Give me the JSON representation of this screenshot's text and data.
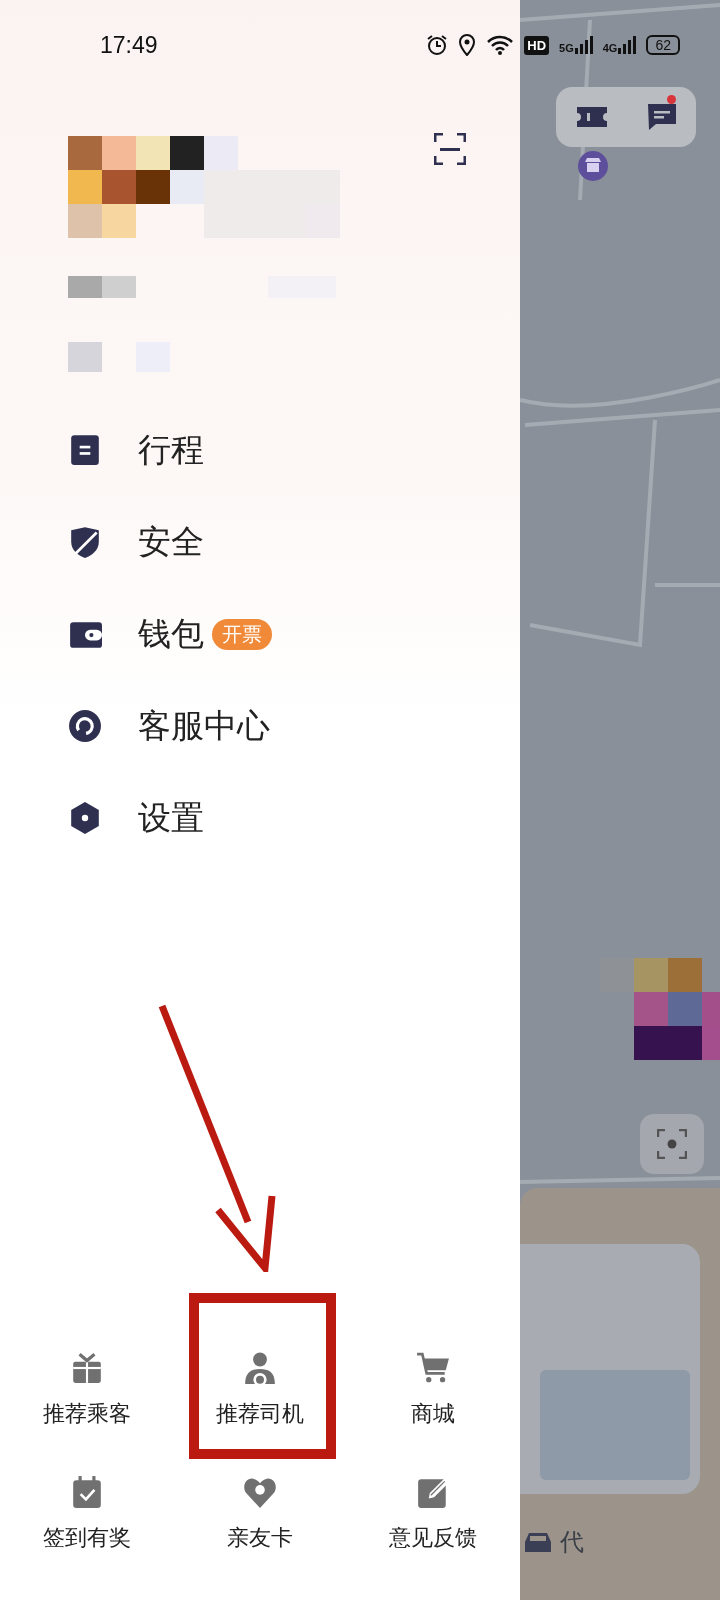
{
  "status_bar": {
    "time": "17:49",
    "hd_badge": "HD",
    "networks": [
      "5G",
      "4G"
    ],
    "battery": "62"
  },
  "profile": {
    "kind": "pixelated"
  },
  "menu": [
    {
      "label": "行程",
      "kind": "trips"
    },
    {
      "label": "安全",
      "kind": "safety"
    },
    {
      "label": "钱包",
      "kind": "wallet",
      "badge": "开票"
    },
    {
      "label": "客服中心",
      "kind": "service"
    },
    {
      "label": "设置",
      "kind": "settings"
    }
  ],
  "shortcuts": [
    {
      "label": "推荐乘客",
      "kind": "gift",
      "highlighted": false
    },
    {
      "label": "推荐司机",
      "kind": "driver",
      "highlighted": true
    },
    {
      "label": "商城",
      "kind": "cart",
      "highlighted": false
    },
    {
      "label": "签到有奖",
      "kind": "calendar",
      "highlighted": false
    },
    {
      "label": "亲友卡",
      "kind": "heart",
      "highlighted": false
    },
    {
      "label": "意见反馈",
      "kind": "edit",
      "highlighted": false
    }
  ],
  "map_pane": {
    "kind": "picture",
    "message_unread": true,
    "bottom_label": "代"
  }
}
